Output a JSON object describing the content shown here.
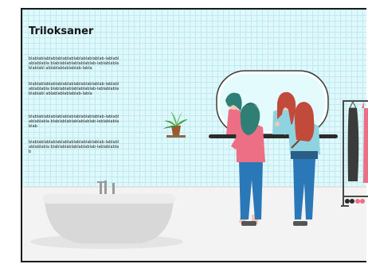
{
  "heading": "Triloksaner",
  "paragraphs": [
    "blablablablablablablablablablablablab-lablablablablabla blablablablablablablab-lablablablablablabl ablablablablablab-labla",
    "blablablablablablablablablablablablab-lablablablablabla blablablablablablablab-lablablablablablabl ablablablablablab-labla",
    "blablablablablablablablablablablablab-lablablablablabla blablablablablablablab-lablablablablab",
    "blablablablablablablablablablablablab-lablablablablabla blablablablablablablab-lablablablab"
  ],
  "colors": {
    "wall": "#dff8fb",
    "grid": "#bfeaf0",
    "floor": "#f3f3f3",
    "shirt": "#ec6f85",
    "jeans": "#2a78b8",
    "hair_teal": "#2f7f76",
    "hair_red": "#c24a3b"
  }
}
